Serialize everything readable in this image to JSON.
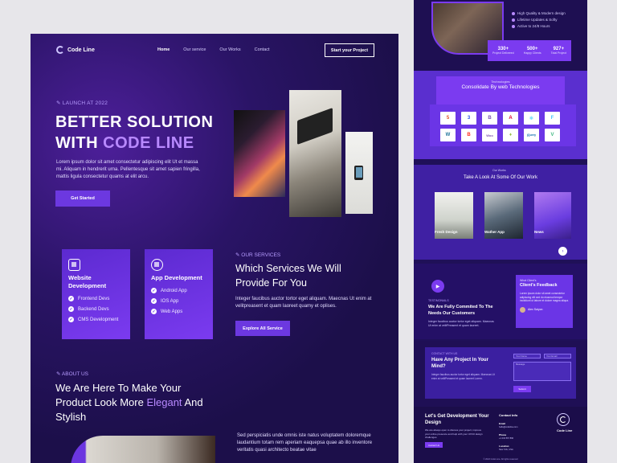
{
  "nav": {
    "brand": "Code Line",
    "links": [
      "Home",
      "Our service",
      "Our Works",
      "Contact"
    ],
    "cta": "Start your Project"
  },
  "hero": {
    "tag": "LAUNCH AT 2022",
    "title_line1": "BETTER SOLUTION",
    "title_line2_prefix": "WITH ",
    "title_line2_accent": "CODE LINE",
    "description": "Lorem ipsum dolor sit amet consectetur adipiscing elit Ut et massa mi. Aliquam in hendrerit urna. Pellentesque sit amet sapien fringilla, mattis ligula consectetur quams at elit arcu.",
    "cta": "Get Started"
  },
  "services": {
    "tag": "OUR SERVICES",
    "heading": "Which Services We Will Provide For You",
    "description": "Integer faucibus auctor tortor eget aliquam. Maecnas Ut enim at velitpreasent et quam laoreet quamy et oplises.",
    "cta": "Explore All Service",
    "cards": [
      {
        "title": "Website Development",
        "items": [
          "Frontend Devs",
          "Backend Devs",
          "CMS Development"
        ]
      },
      {
        "title": "App Development",
        "items": [
          "Android App",
          "IOS App",
          "Web Apps"
        ]
      }
    ]
  },
  "about": {
    "tag": "ABOUT US",
    "title_prefix": "We Are Here To Make Your Product Look More ",
    "title_accent": "Elegant",
    "title_suffix": " And Stylish",
    "description": "Sed perspiciatis unde omnis iste natus voluptatem doloremque laudantium totam rem aperiam eaquepsa quae ab illo inventore veritatis quasi architecto beatae vitae"
  },
  "preview": {
    "features": [
      "High Quality & Modern design",
      "Lifetime Updates & Softy",
      "Active to 24/8 Hours"
    ],
    "stats": [
      {
        "value": "330+",
        "label": "Project Delivered"
      },
      {
        "value": "500+",
        "label": "Happy Clients"
      },
      {
        "value": "927+",
        "label": "Total Project"
      }
    ],
    "tech": {
      "tag": "Technologies",
      "title": "Consolidate By web Technologies",
      "logos": [
        "5",
        "3",
        "B",
        "A",
        "⚛",
        "F",
        "W",
        "B",
        "Woo",
        "♦",
        "jQuery",
        "V"
      ]
    },
    "works": {
      "tag": "Our Works",
      "title": "Take A Look At Some Of Our Work",
      "items": [
        "Fresh Design",
        "Wather App",
        "News"
      ],
      "next": "›"
    },
    "feedback": {
      "tag": "TESTIMONIALS",
      "title": "We Are Fully Commited To The Needs Our Customers",
      "description": "Integer faucibus auctor tortor eget aliquam. Maecnas Ut enim at velitPreasent et quam laoreet.",
      "card_tag": "What Client's",
      "card_title": "Client's Feedback",
      "quote": "Lorem ipsum dolor sit amet consectetur adipiscing elit sed do eiusmod tempor incididunt ut labore et dolore magna aliqua.",
      "name": "Alex Saiyon"
    },
    "contact": {
      "tag": "CONTACT WITH US",
      "title": "Have Any Project In Your Mind?",
      "description": "Integer faucibus auctor tortor eget aliquam. Maecnas Ut enim at velitPreasent et quam laoreet Lorem.",
      "fields": [
        "Your Name",
        "Your Email",
        "Message"
      ],
      "send": "Submit"
    },
    "footer": {
      "title": "Let's Get Development Your Design",
      "description": "We are always open to discuss your project, improve your online presence and help with your UX/UI design challenges.",
      "cta": "Contact Us",
      "info_title": "Contact Info",
      "email_label": "Email",
      "phone_label": "Phone",
      "location_label": "Location",
      "email": "hello@codeline.com",
      "phone": "+1 234 567 890",
      "location": "New York, USA",
      "brand": "Code Line",
      "copyright": "© 2022 Code Line. All rights reserved"
    }
  }
}
